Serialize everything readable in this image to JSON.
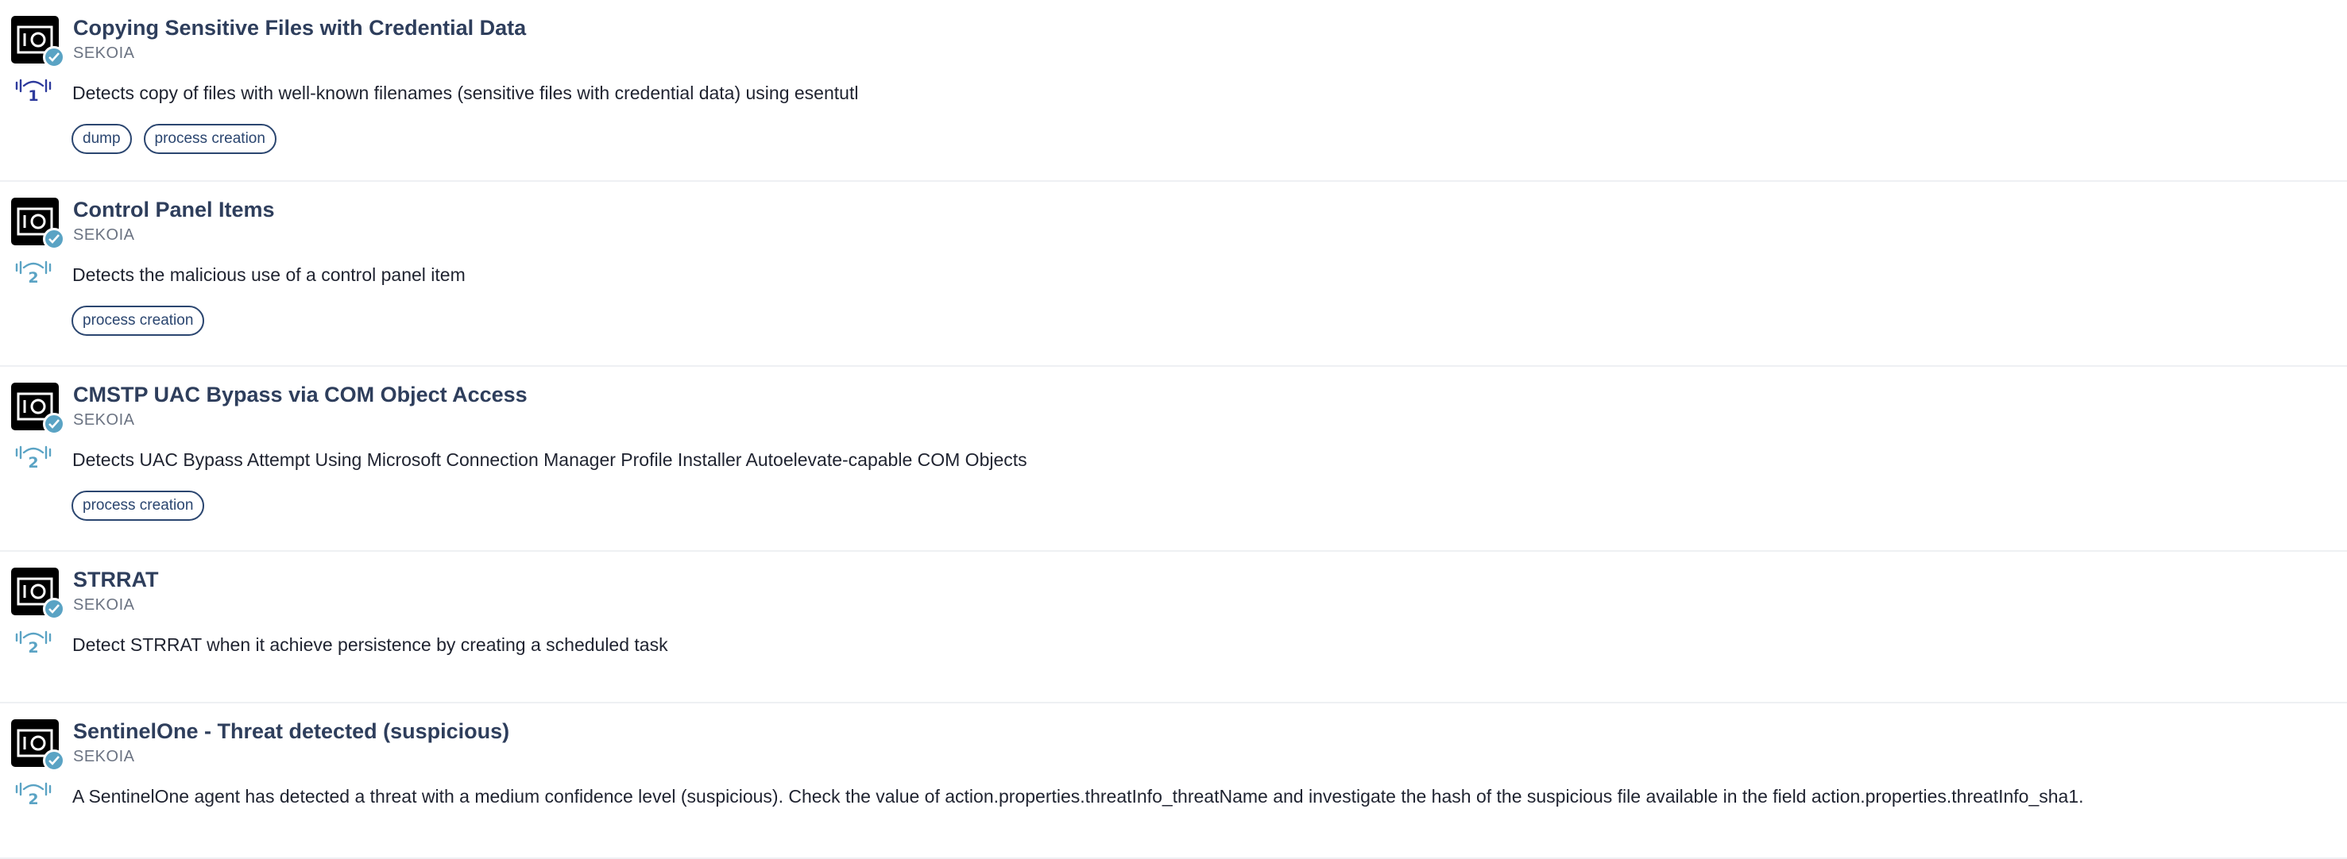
{
  "colors": {
    "title": "#2e3e5c",
    "tag_border": "#2b4670",
    "level_1": "#2d3a9c",
    "level_2": "#5aa3c4",
    "verified_badge": "#5aa3c4"
  },
  "rules": [
    {
      "title": "Copying Sensitive Files with Credential Data",
      "vendor": "SEKOIA",
      "level": "1",
      "level_icon": "signal-level-icon",
      "description": "Detects copy of files with well-known filenames (sensitive files with credential data) using esentutl",
      "tags": [
        "dump",
        "process creation"
      ]
    },
    {
      "title": "Control Panel Items",
      "vendor": "SEKOIA",
      "level": "2",
      "level_icon": "signal-level-icon",
      "description": "Detects the malicious use of a control panel item",
      "tags": [
        "process creation"
      ]
    },
    {
      "title": "CMSTP UAC Bypass via COM Object Access",
      "vendor": "SEKOIA",
      "level": "2",
      "level_icon": "signal-level-icon",
      "description": "Detects UAC Bypass Attempt Using Microsoft Connection Manager Profile Installer Autoelevate-capable COM Objects",
      "tags": [
        "process creation"
      ]
    },
    {
      "title": "STRRAT",
      "vendor": "SEKOIA",
      "level": "2",
      "level_icon": "signal-level-icon",
      "description": "Detect STRRAT when it achieve persistence by creating a scheduled task",
      "tags": []
    },
    {
      "title": "SentinelOne - Threat detected (suspicious)",
      "vendor": "SEKOIA",
      "level": "2",
      "level_icon": "signal-level-icon",
      "description": "A SentinelOne agent has detected a threat with a medium confidence level (suspicious). Check the value of action.properties.threatInfo_threatName and investigate the hash of the suspicious file available in the field action.properties.threatInfo_sha1.",
      "tags": []
    }
  ]
}
